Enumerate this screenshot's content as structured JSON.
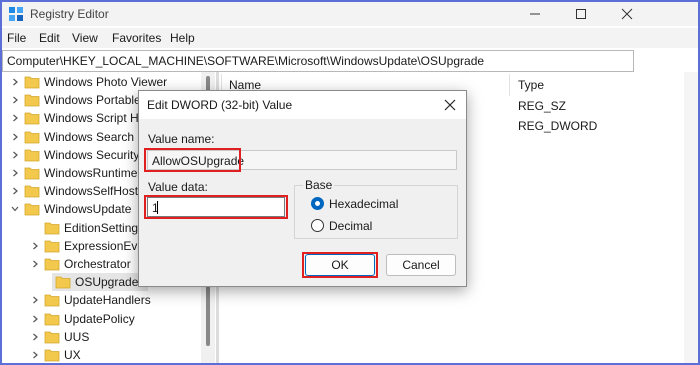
{
  "window": {
    "title": "Registry Editor",
    "minimize_icon": "minimize-icon",
    "maximize_icon": "maximize-icon",
    "close_icon": "close-icon"
  },
  "menu": [
    "File",
    "Edit",
    "View",
    "Favorites",
    "Help"
  ],
  "address": "Computer\\HKEY_LOCAL_MACHINE\\SOFTWARE\\Microsoft\\WindowsUpdate\\OSUpgrade",
  "tree": [
    {
      "label": "Windows Photo Viewer",
      "expanded": false,
      "selected": false,
      "level": 0
    },
    {
      "label": "Windows Portable",
      "expanded": false,
      "selected": false,
      "level": 0
    },
    {
      "label": "Windows Script H",
      "expanded": false,
      "selected": false,
      "level": 0
    },
    {
      "label": "Windows Search",
      "expanded": false,
      "selected": false,
      "level": 0
    },
    {
      "label": "Windows Security",
      "expanded": false,
      "selected": false,
      "level": 0
    },
    {
      "label": "WindowsRuntime",
      "expanded": false,
      "selected": false,
      "level": 0
    },
    {
      "label": "WindowsSelfHost",
      "expanded": false,
      "selected": false,
      "level": 0
    },
    {
      "label": "WindowsUpdate",
      "expanded": true,
      "selected": false,
      "level": 0
    },
    {
      "label": "EditionSettings",
      "expanded": false,
      "selected": false,
      "level": 1,
      "leaf": true
    },
    {
      "label": "ExpressionEval",
      "expanded": false,
      "selected": false,
      "level": 1
    },
    {
      "label": "Orchestrator",
      "expanded": false,
      "selected": false,
      "level": 1
    },
    {
      "label": "OSUpgrade",
      "expanded": false,
      "selected": true,
      "level": 1,
      "leaf": true
    },
    {
      "label": "UpdateHandlers",
      "expanded": false,
      "selected": false,
      "level": 1
    },
    {
      "label": "UpdatePolicy",
      "expanded": false,
      "selected": false,
      "level": 1
    },
    {
      "label": "UUS",
      "expanded": false,
      "selected": false,
      "level": 1
    },
    {
      "label": "UX",
      "expanded": false,
      "selected": false,
      "level": 1
    }
  ],
  "list": {
    "columns": {
      "name": "Name",
      "type": "Type"
    },
    "rows": [
      {
        "type": "REG_SZ"
      },
      {
        "type": "REG_DWORD"
      }
    ]
  },
  "dialog": {
    "title": "Edit DWORD (32-bit) Value",
    "value_name_label": "Value name:",
    "value_name": "AllowOSUpgrade",
    "value_data_label": "Value data:",
    "value_data": "1",
    "base_label": "Base",
    "hex_label": "Hexadecimal",
    "dec_label": "Decimal",
    "selected_base": "Hexadecimal",
    "ok_label": "OK",
    "cancel_label": "Cancel"
  },
  "colors": {
    "highlight_red": "#e02020",
    "accent_blue": "#0067c0",
    "folder_yellow": "#f2c94c"
  }
}
